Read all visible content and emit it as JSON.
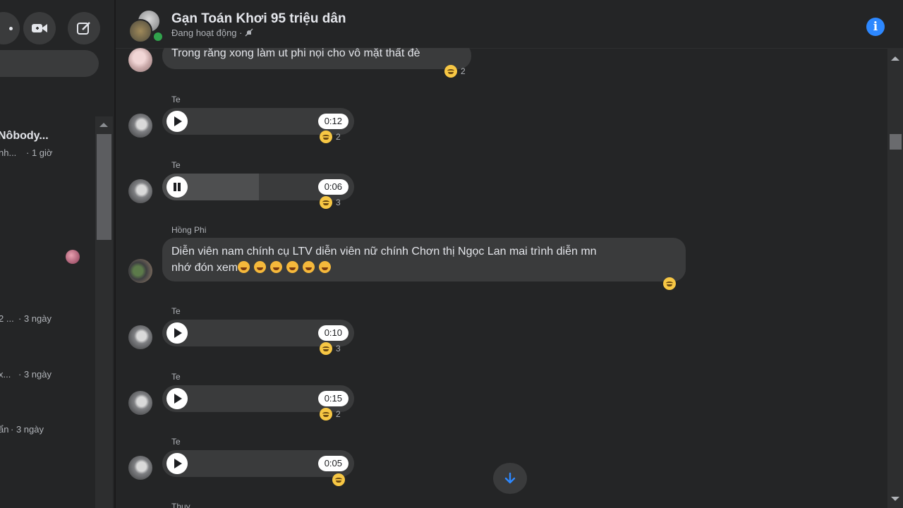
{
  "sidebar": {
    "top_icons": [
      "more-icon",
      "video-call-icon",
      "new-message-icon"
    ],
    "conversations": [
      {
        "name": "Nôbody...",
        "preview": "nh...",
        "time": "· 1 giờ"
      },
      {
        "preview": "2 ...",
        "time": "· 3 ngày"
      },
      {
        "preview": "x...",
        "time": "· 3 ngày"
      },
      {
        "preview": "ẩn",
        "time": "· 3 ngày"
      }
    ]
  },
  "header": {
    "title": "Gạn Toán Khơi 95 triệu dân",
    "status": "Đang hoạt động ·",
    "status_icon": "muted-bell-icon",
    "info_icon": "info-icon"
  },
  "messages": [
    {
      "type": "text",
      "text": "Trong răng xong làm ut phi nọi cho vô mặt thất đè",
      "reaction": "😊",
      "reaction_count": "2"
    },
    {
      "type": "voice",
      "sender": "Te",
      "state": "paused",
      "duration": "0:12",
      "progress": 0,
      "reaction": "😊",
      "reaction_count": "2"
    },
    {
      "type": "voice",
      "sender": "Te",
      "state": "playing",
      "duration": "0:06",
      "progress": 0.5,
      "reaction": "😊",
      "reaction_count": "3"
    },
    {
      "type": "text",
      "sender": "Hồng Phi",
      "line1": "Diễn viên nam chính cụ LTV diễn viên nữ chính Chơn thị Ngọc Lan mai trình diễn mn",
      "line2": "nhớ đón xem",
      "reaction": "😊",
      "reaction_count": ""
    },
    {
      "type": "voice",
      "sender": "Te",
      "state": "paused",
      "duration": "0:10",
      "progress": 0,
      "reaction": "😊",
      "reaction_count": "3"
    },
    {
      "type": "voice",
      "sender": "Te",
      "state": "paused",
      "duration": "0:15",
      "progress": 0,
      "reaction": "😊",
      "reaction_count": "2"
    },
    {
      "type": "voice",
      "sender": "Te",
      "state": "paused",
      "duration": "0:05",
      "progress": 0,
      "reaction": "😊",
      "reaction_count": ""
    },
    {
      "type": "partial",
      "sender": "Thuy"
    }
  ],
  "colors": {
    "background": "#242526",
    "bubble": "#3a3b3c",
    "accent": "#2d88ff",
    "online": "#31a24c"
  }
}
